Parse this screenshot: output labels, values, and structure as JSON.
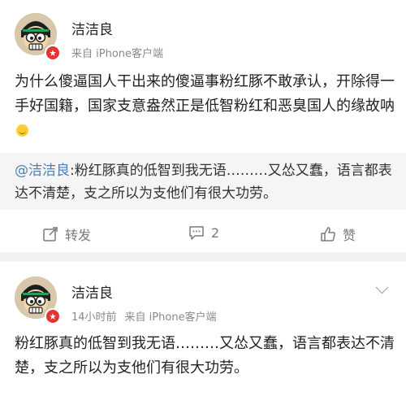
{
  "post1": {
    "username": "洁洁良",
    "source": "来自 iPhone客户端",
    "text": "为什么傻逼国人干出来的傻逼事粉红豚不敢承认，开除得一手好国籍，国家支意盎然正是低智粉红和恶臭国人的缘故呐",
    "repost": {
      "mention": "@洁洁良",
      "text": ":粉红豚真的低智到我无语………又怂又蠢，语言都表达不清楚，支之所以为支他们有很大功劳。"
    },
    "actions": {
      "repost_label": "转发",
      "comment_count": "2",
      "like_label": "赞"
    }
  },
  "post2": {
    "username": "洁洁良",
    "time": "14小时前",
    "source": "来自 iPhone客户端",
    "text": "粉红豚真的低智到我无语………又怂又蠢，语言都表达不清楚，支之所以为支他们有很大功劳。"
  },
  "icons": {
    "repost": "edit-share-icon",
    "comment": "comment-icon",
    "like": "thumbs-up-icon",
    "more": "chevron-down-icon",
    "verified": "verified-badge-icon"
  },
  "colors": {
    "mention": "#4a7fb8",
    "badge": "#e8322f",
    "background": "#f2f2f2",
    "repost_bg": "#f5f5f5"
  }
}
